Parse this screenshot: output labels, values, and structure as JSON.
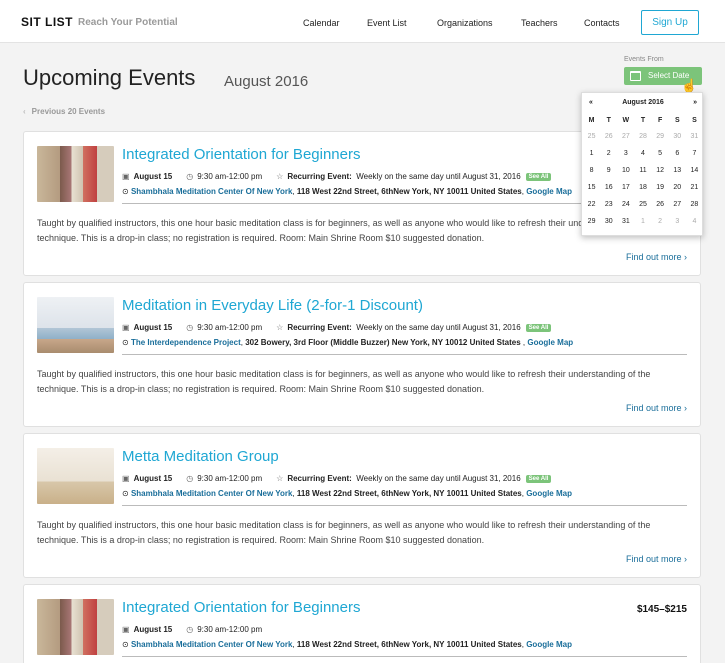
{
  "header": {
    "brand": "SIT LIST",
    "tagline": "Reach Your Potential",
    "nav": [
      "Calendar",
      "Event  List",
      "Organizations",
      "Teachers",
      "Contacts"
    ],
    "signup": "Sign Up"
  },
  "page": {
    "title": "Upcoming Events",
    "month": "August 2016",
    "previous": "Previous 20 Events",
    "events_from_label": "Events From",
    "select_date": "Select Date"
  },
  "calendar": {
    "prev": "«",
    "next": "»",
    "month_label": "August 2016",
    "weekdays": [
      "M",
      "T",
      "W",
      "T",
      "F",
      "S",
      "S"
    ],
    "days": [
      [
        "25",
        "26",
        "27",
        "28",
        "29",
        "30",
        "31"
      ],
      [
        "1",
        "2",
        "3",
        "4",
        "5",
        "6",
        "7"
      ],
      [
        "8",
        "9",
        "10",
        "11",
        "12",
        "13",
        "14"
      ],
      [
        "15",
        "16",
        "17",
        "18",
        "19",
        "20",
        "21"
      ],
      [
        "22",
        "23",
        "24",
        "25",
        "26",
        "27",
        "28"
      ],
      [
        "29",
        "30",
        "31",
        "1",
        "2",
        "3",
        "4"
      ]
    ]
  },
  "events": [
    {
      "title": "Integrated Orientation for Beginners",
      "price": "",
      "date": "August 15",
      "time": "9:30 am-12:00 pm",
      "recurring_label": "Recurring Event:",
      "recurring_text": "Weekly on the same day until August 31, 2016",
      "see_all": "See All",
      "venue": "Shambhala Meditation Center Of New York",
      "address": "118 West 22nd Street, 6thNew York, NY 10011 United States",
      "map": "Google Map",
      "description": "Taught by qualified instructors, this one hour basic meditation class is for beginners, as well as anyone who would like to refresh their understanding of the technique. This is a drop-in class; no registration is required. Room: Main Shrine Room $10 suggested donation.",
      "more": "Find out more"
    },
    {
      "title": "Meditation in Everyday Life (2-for-1 Discount)",
      "price": "",
      "date": "August 15",
      "time": "9:30 am-12:00 pm",
      "recurring_label": "Recurring Event:",
      "recurring_text": "Weekly on the same day until August 31, 2016",
      "see_all": "See All",
      "venue": "The Interdependence Project",
      "address": "302 Bowery, 3rd Floor (Middle Buzzer) New York, NY 10012 United States",
      "map": "Google Map",
      "description": "Taught by qualified instructors, this one hour basic meditation class is for beginners, as well as anyone who would like to refresh their understanding of the technique. This is a drop-in class; no registration is required. Room: Main Shrine Room $10 suggested donation.",
      "more": "Find out more"
    },
    {
      "title": "Metta Meditation Group",
      "price": "",
      "date": "August 15",
      "time": "9:30 am-12:00 pm",
      "recurring_label": "Recurring Event:",
      "recurring_text": "Weekly on the same day until August 31, 2016",
      "see_all": "See All",
      "venue": "Shambhala Meditation Center Of New York",
      "address": "118 West 22nd Street, 6thNew York, NY 10011 United States",
      "map": "Google Map",
      "description": "Taught by qualified instructors, this one hour basic meditation class is for beginners, as well as anyone who would like to refresh their understanding of the technique. This is a drop-in class; no registration is required. Room: Main Shrine Room $10 suggested donation.",
      "more": "Find out more"
    },
    {
      "title": "Integrated Orientation for Beginners",
      "price": "$145–$215",
      "date": "August 15",
      "time": "9:30 am-12:00 pm",
      "venue": "Shambhala Meditation Center Of New York",
      "address": "118 West 22nd Street, 6thNew York, NY 10011 United States",
      "map": "Google Map"
    }
  ]
}
